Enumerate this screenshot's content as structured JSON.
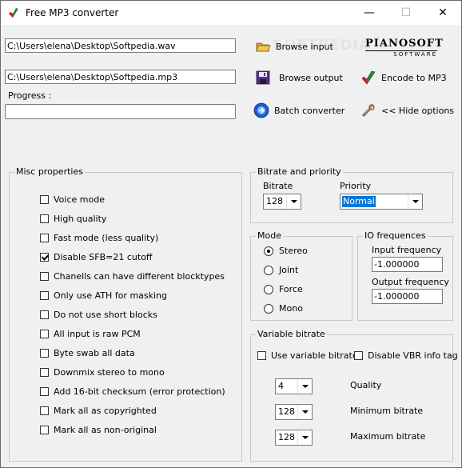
{
  "window": {
    "title": "Free MP3 converter",
    "min": "—",
    "max": "☐",
    "close": "✕"
  },
  "watermark": "SOFTPEDIA",
  "input_path": "C:\\Users\\elena\\Desktop\\Softpedia.wav",
  "output_path": "C:\\Users\\elena\\Desktop\\Softpedia.mp3",
  "progress_label": "Progress :",
  "progress": 0,
  "buttons": {
    "browse_input": "Browse input",
    "browse_output": "Browse output",
    "batch": "Batch converter",
    "encode": "Encode to MP3",
    "hide": "<< Hide options"
  },
  "logo": {
    "line1": "PIANOSOFT",
    "line2": "SOFTWARE"
  },
  "misc": {
    "title": "Misc properties",
    "items": [
      {
        "label": "Voice mode",
        "checked": false
      },
      {
        "label": "High quality",
        "checked": false
      },
      {
        "label": "Fast mode (less quality)",
        "checked": false
      },
      {
        "label": "Disable SFB=21 cutoff",
        "checked": true
      },
      {
        "label": "Chanells can have different blocktypes",
        "checked": false
      },
      {
        "label": "Only use ATH for masking",
        "checked": false
      },
      {
        "label": "Do not use short blocks",
        "checked": false
      },
      {
        "label": "All input is raw PCM",
        "checked": false
      },
      {
        "label": "Byte swab all data",
        "checked": false
      },
      {
        "label": "Downmix stereo to mono",
        "checked": false
      },
      {
        "label": "Add 16-bit checksum (error protection)",
        "checked": false
      },
      {
        "label": "Mark all as copyrighted",
        "checked": false
      },
      {
        "label": "Mark all as non-original",
        "checked": false
      }
    ]
  },
  "bitrate_priority": {
    "title": "Bitrate and priority",
    "bitrate_label": "Bitrate",
    "bitrate_value": "128",
    "priority_label": "Priority",
    "priority_value": "Normal"
  },
  "mode": {
    "title": "Mode",
    "options": [
      "Stereo",
      "Joint",
      "Force",
      "Mono"
    ],
    "selected": "Stereo"
  },
  "io": {
    "title": "IO frequences",
    "input_label": "Input frequency",
    "input_value": "-1.000000",
    "output_label": "Output frequency",
    "output_value": "-1.000000"
  },
  "vbr": {
    "title": "Variable bitrate",
    "use_vbr": "Use variable bitrate",
    "disable_tag": "Disable VBR info tag",
    "quality_label": "Quality",
    "quality_value": "4",
    "min_label": "Minimum bitrate",
    "min_value": "128",
    "max_label": "Maximum bitrate",
    "max_value": "128"
  },
  "colors": {
    "accent": "#0078d7",
    "border": "#c8c8c8"
  }
}
